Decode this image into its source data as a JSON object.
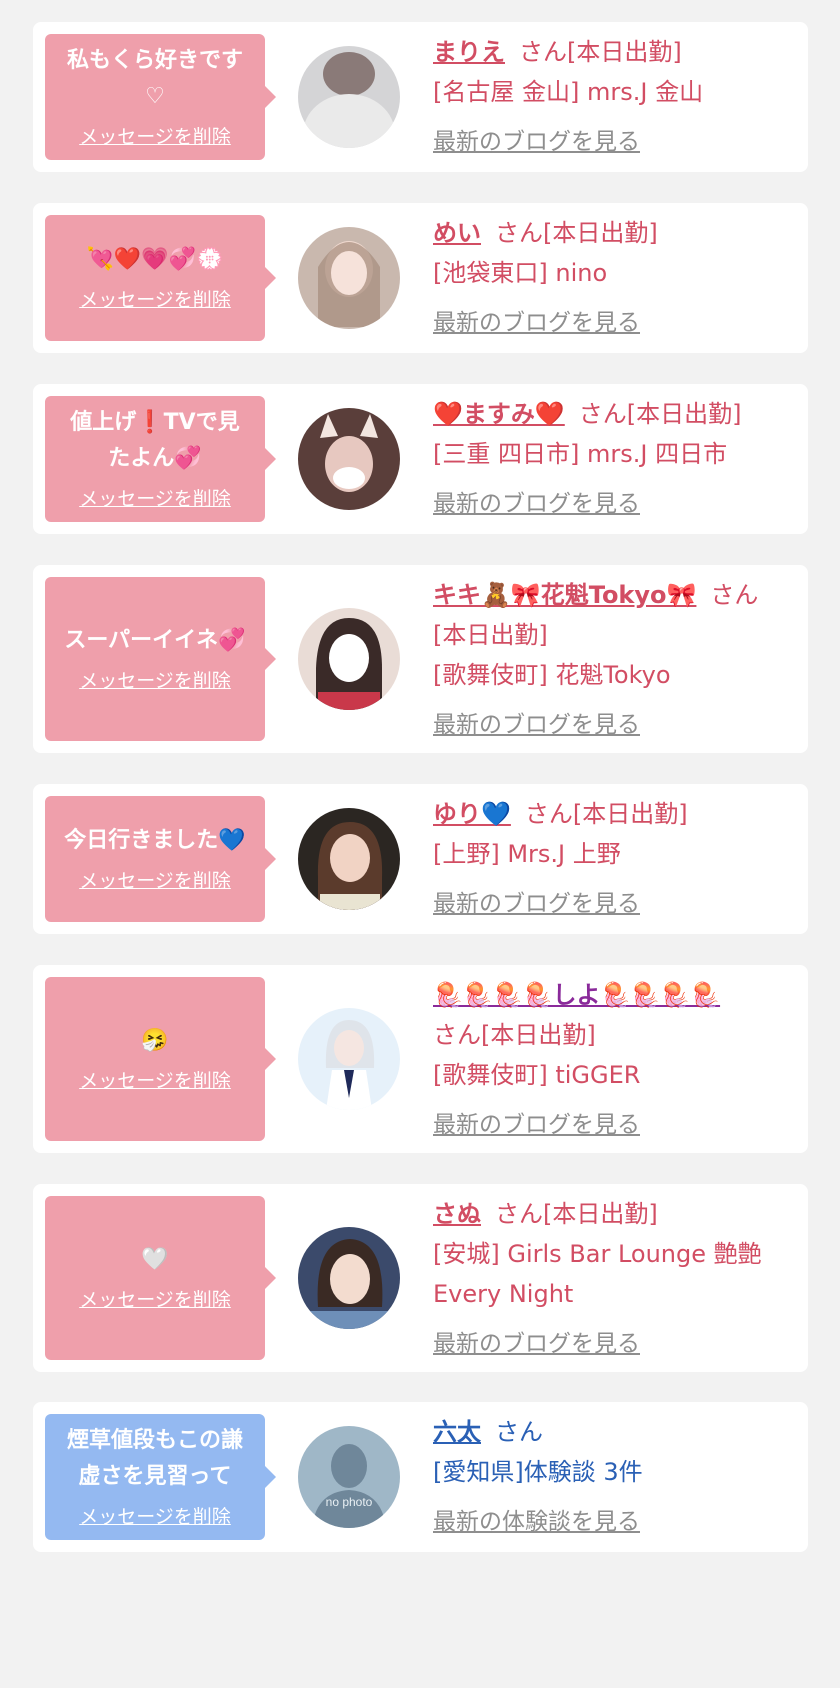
{
  "delete_label": "メッセージを削除",
  "cards": [
    {
      "message": "私もくら好きです♡",
      "name": "まりえ",
      "status": "さん[本日出勤]",
      "shop": "[名古屋 金山] mrs.J 金山",
      "blog": "最新のブログを見る"
    },
    {
      "message": "💘❤️💗💞💮",
      "name": "めい",
      "status": "さん[本日出勤]",
      "shop": "[池袋東口] nino",
      "blog": "最新のブログを見る"
    },
    {
      "message": "値上げ❗️TVで見たよん💞",
      "name": "❤️ますみ❤️",
      "status": "さん[本日出勤]",
      "shop": "[三重 四日市] mrs.J 四日市",
      "blog": "最新のブログを見る"
    },
    {
      "message": "スーパーイイネ💞",
      "name": "キキ🧸🎀花魁Tokyo🎀",
      "status": "さん",
      "status2": "[本日出勤]",
      "shop": "[歌舞伎町] 花魁Tokyo",
      "blog": "最新のブログを見る"
    },
    {
      "message": "今日行きました💙",
      "name": "ゆり💙",
      "status": "さん[本日出勤]",
      "shop": "[上野] Mrs.J 上野",
      "blog": "最新のブログを見る"
    },
    {
      "message": "🤧",
      "name": "🪼🪼🪼🪼しよ🪼🪼🪼🪼",
      "status": "さん[本日出勤]",
      "shop": "[歌舞伎町] tiGGER",
      "blog": "最新のブログを見る"
    },
    {
      "message": "🤍",
      "name": "さぬ",
      "status": "さん[本日出勤]",
      "shop": "[安城] Girls Bar Lounge 艶艶 Every Night",
      "blog": "最新のブログを見る"
    },
    {
      "message": "煙草値段もこの謙虚さを見習って",
      "name": "六太",
      "status": "さん",
      "shop": "[愛知県]体験談 3件",
      "blog": "最新の体験談を見る",
      "avatar_text": "no photo"
    }
  ],
  "colors": {
    "pink_bubble": "#ef9fab",
    "blue_bubble": "#94b9f1",
    "cast_name": "#d24d63",
    "user_name": "#2a60b5",
    "link_gray": "#8e8e8e"
  },
  "icons": {
    "avatar": "avatar-photo",
    "no_photo": "silhouette-icon"
  }
}
